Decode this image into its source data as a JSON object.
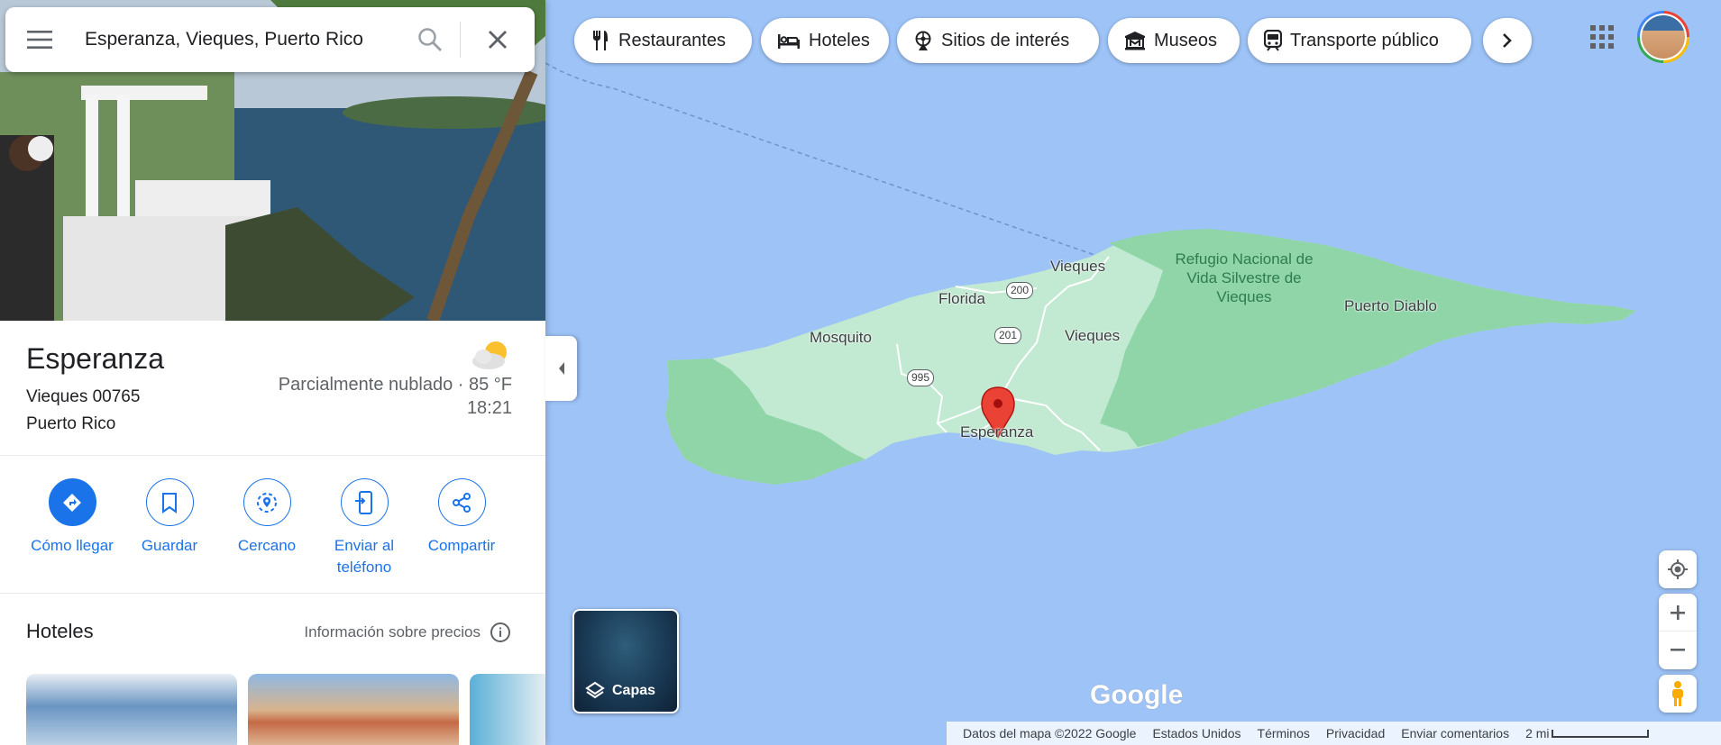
{
  "search": {
    "query": "Esperanza, Vieques, Puerto Rico"
  },
  "place": {
    "name": "Esperanza",
    "address_line1": "Vieques 00765",
    "address_line2": "Puerto Rico",
    "weather": "Parcialmente nublado · 85 °F",
    "time": "18:21"
  },
  "actions": [
    {
      "label": "Cómo llegar",
      "icon": "directions-icon"
    },
    {
      "label": "Guardar",
      "icon": "bookmark-icon"
    },
    {
      "label": "Cercano",
      "icon": "nearby-icon"
    },
    {
      "label": "Enviar al teléfono",
      "icon": "send-to-phone-icon"
    },
    {
      "label": "Compartir",
      "icon": "share-icon"
    }
  ],
  "hotels": {
    "title": "Hoteles",
    "price_info": "Información sobre precios"
  },
  "chips": [
    {
      "label": "Restaurantes",
      "icon": "restaurant-icon"
    },
    {
      "label": "Hoteles",
      "icon": "hotel-icon"
    },
    {
      "label": "Sitios de interés",
      "icon": "attraction-icon"
    },
    {
      "label": "Museos",
      "icon": "museum-icon"
    },
    {
      "label": "Transporte público",
      "icon": "transit-icon"
    }
  ],
  "map": {
    "labels": {
      "vieques_north": "Vieques",
      "florida": "Florida",
      "mosquito": "Mosquito",
      "vieques_center": "Vieques",
      "esperanza": "Esperanza",
      "puerto_diablo": "Puerto Diablo",
      "refugio": "Refugio Nacional de Vida Silvestre de Vieques"
    },
    "roads": [
      "200",
      "201",
      "995"
    ]
  },
  "layers": {
    "label": "Capas"
  },
  "brand": {
    "logo": "Google"
  },
  "footer": {
    "map_data": "Datos del mapa ©2022 Google",
    "country": "Estados Unidos",
    "terms": "Términos",
    "privacy": "Privacidad",
    "feedback": "Enviar comentarios",
    "scale": "2 mi"
  },
  "colors": {
    "accent": "#1a73e8",
    "water": "#9dc3f7",
    "land": "#c0e8cf",
    "refuge": "#8fd5a8",
    "pin": "#ea4335"
  }
}
